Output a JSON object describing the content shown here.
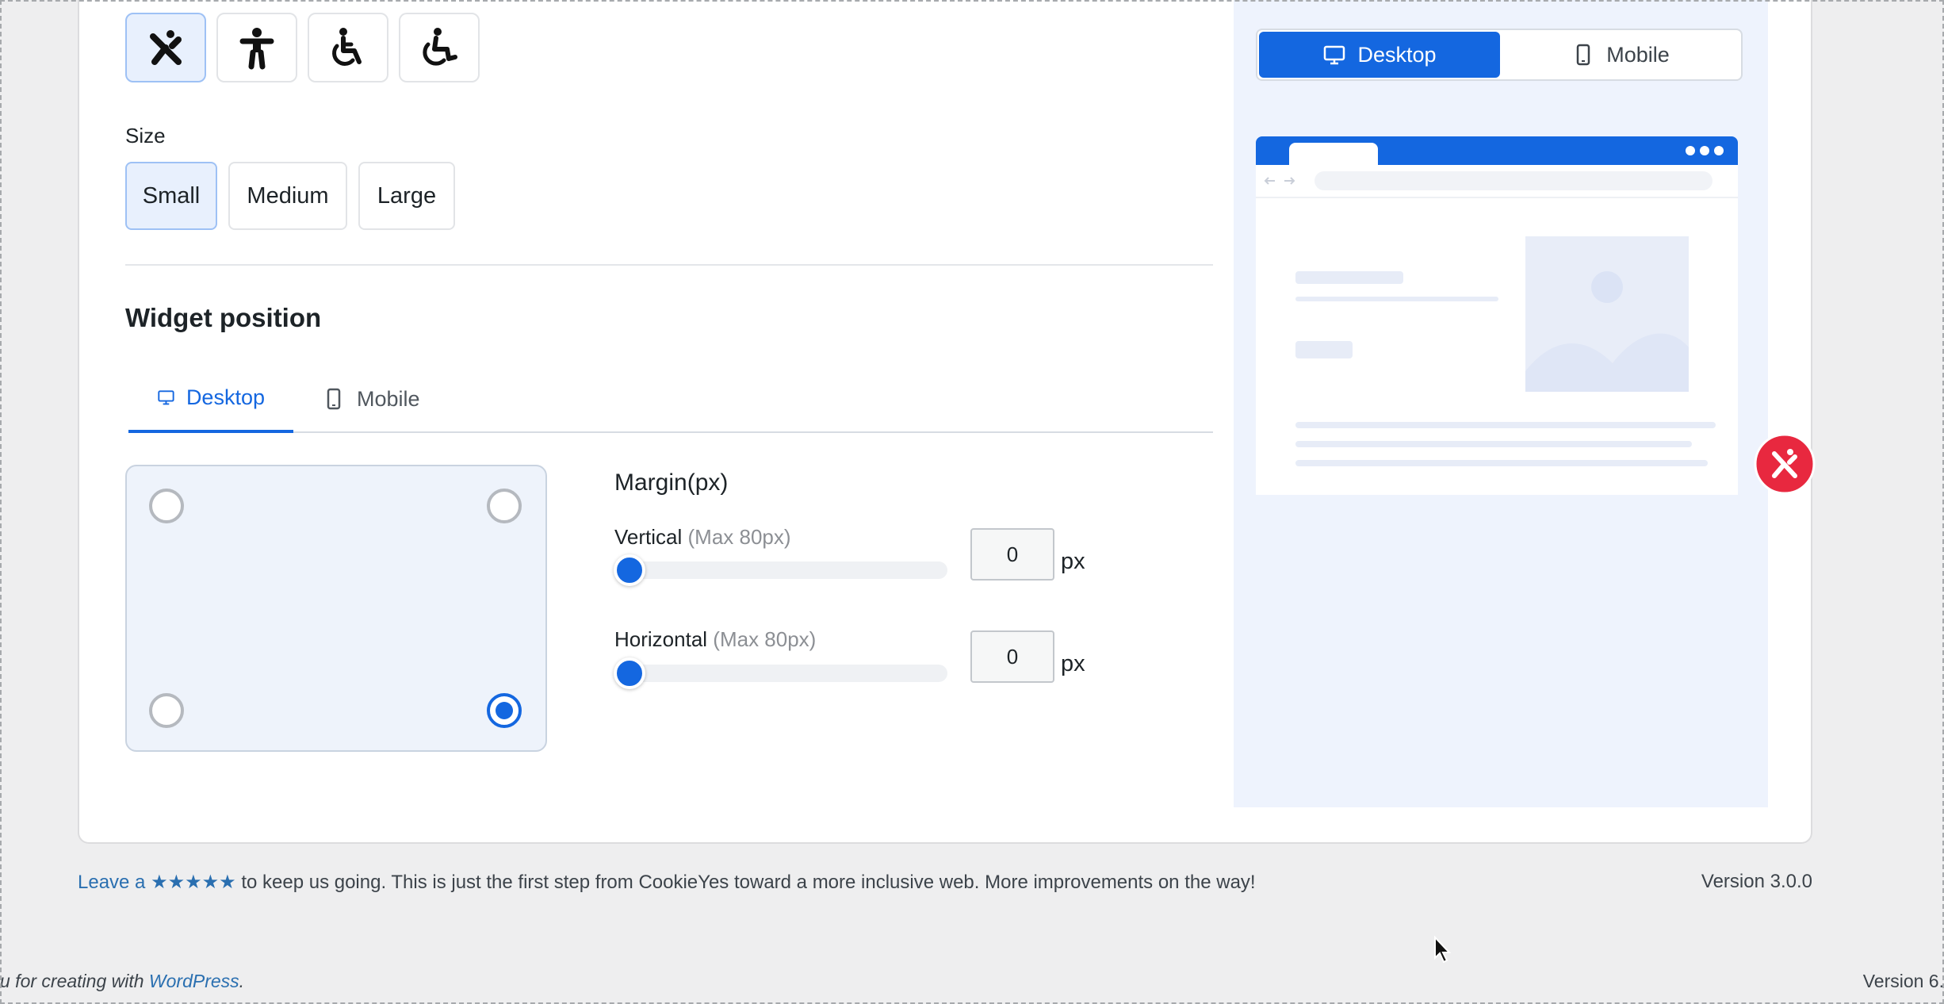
{
  "icons": {
    "selected_index": 0,
    "items": [
      "accessibility-x-icon",
      "person-icon",
      "wheelchair-icon",
      "wheelchair-active-icon"
    ]
  },
  "size": {
    "label": "Size",
    "options": [
      "Small",
      "Medium",
      "Large"
    ],
    "selected": "Small"
  },
  "widget_position": {
    "title": "Widget position",
    "tabs": [
      "Desktop",
      "Mobile"
    ],
    "active_tab": "Desktop",
    "selected_corner": "bottom-right",
    "margin_title": "Margin(px)",
    "vertical": {
      "label": "Vertical",
      "hint": "(Max 80px)",
      "value": "0",
      "max": 80,
      "level": 0,
      "unit": "px"
    },
    "horizontal": {
      "label": "Horizontal",
      "hint": "(Max 80px)",
      "value": "0",
      "max": 80,
      "level": 0,
      "unit": "px"
    }
  },
  "preview": {
    "toggle": [
      "Desktop",
      "Mobile"
    ],
    "active": "Desktop"
  },
  "footer": {
    "leave_a": "Leave a",
    "stars": "★★★★★",
    "message": " to keep us going. This is just the first step from CookieYes toward a more inclusive web. More improvements on the way!",
    "version": "Version 3.0.0"
  },
  "wp_footer": {
    "thanks": "u for creating with ",
    "wordpress": "WordPress",
    "period": ".",
    "version": "Version 6."
  },
  "colors": {
    "accent": "#1467e0",
    "fab": "#e8283f",
    "selected_bg": "#e8f0fd"
  }
}
